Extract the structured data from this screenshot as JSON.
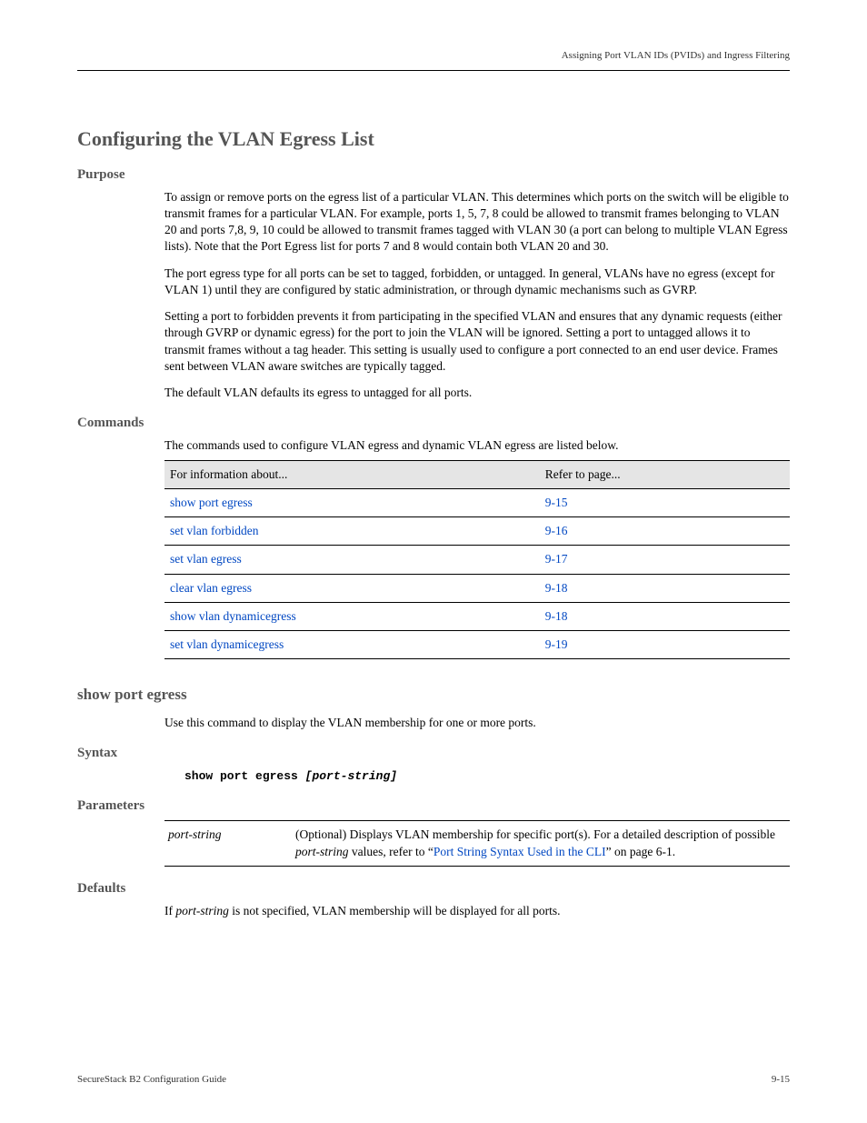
{
  "header": {
    "right": "Assigning Port VLAN IDs (PVIDs) and Ingress Filtering"
  },
  "section": {
    "title": "Configuring the VLAN Egress List"
  },
  "purpose": {
    "title": "Purpose",
    "p1": "To assign or remove ports on the egress list of a particular VLAN. This determines which ports on the switch will be eligible to transmit frames for a particular VLAN. For example, ports 1, 5, 7, 8 could be allowed to transmit frames belonging to VLAN 20 and ports 7,8, 9, 10 could be allowed to transmit frames tagged with VLAN 30 (a port can belong to multiple VLAN Egress lists). Note that the Port Egress list for ports 7 and 8 would contain both VLAN 20 and 30.",
    "p2": "The port egress type for all ports can be set to tagged, forbidden, or untagged. In general, VLANs have no egress (except for VLAN 1) until they are configured by static administration, or through dynamic mechanisms such as GVRP.",
    "p3": "Setting a port to forbidden prevents it from participating in the specified VLAN and ensures that any dynamic requests (either through GVRP or dynamic egress) for the port to join the VLAN will be ignored. Setting a port to untagged allows it to transmit frames without a tag header. This setting is usually used to configure a port connected to an end user device. Frames sent between VLAN aware switches are typically tagged.",
    "p4": "The default VLAN defaults its egress to untagged for all ports."
  },
  "commands": {
    "title": "Commands",
    "intro": "The commands used to configure VLAN egress and dynamic VLAN egress are listed below.",
    "header_task": "For information about...",
    "header_page": "Refer to page...",
    "rows": [
      {
        "task": "show port egress",
        "page": "9-15"
      },
      {
        "task": "set vlan forbidden",
        "page": "9-16"
      },
      {
        "task": "set vlan egress",
        "page": "9-17"
      },
      {
        "task": "clear vlan egress",
        "page": "9-18"
      },
      {
        "task": "show vlan dynamicegress",
        "page": "9-18"
      },
      {
        "task": "set vlan dynamicegress",
        "page": "9-19"
      }
    ]
  },
  "command": {
    "name": "show port egress",
    "desc": "Use this command to display the VLAN membership for one or more ports.",
    "syntax_title": "Syntax",
    "syntax_cmd": "show port egress",
    "syntax_opt": "[port-string]",
    "params_title": "Parameters",
    "param_name": "port-string",
    "param_desc_pre": "(Optional) Displays VLAN membership for specific port(s). For a detailed description of possible ",
    "param_desc_italic": "port-string",
    "param_desc_mid": " values, refer to “",
    "param_xref": "Port String Syntax Used in the CLI",
    "param_desc_post": "” on page 6-1.",
    "defaults_title": "Defaults",
    "defaults_pre": "If ",
    "defaults_italic": "port-string",
    "defaults_post": " is not specified, VLAN membership will be displayed for all ports."
  },
  "footer": {
    "left": "SecureStack B2 Configuration Guide",
    "right": "9-15"
  }
}
